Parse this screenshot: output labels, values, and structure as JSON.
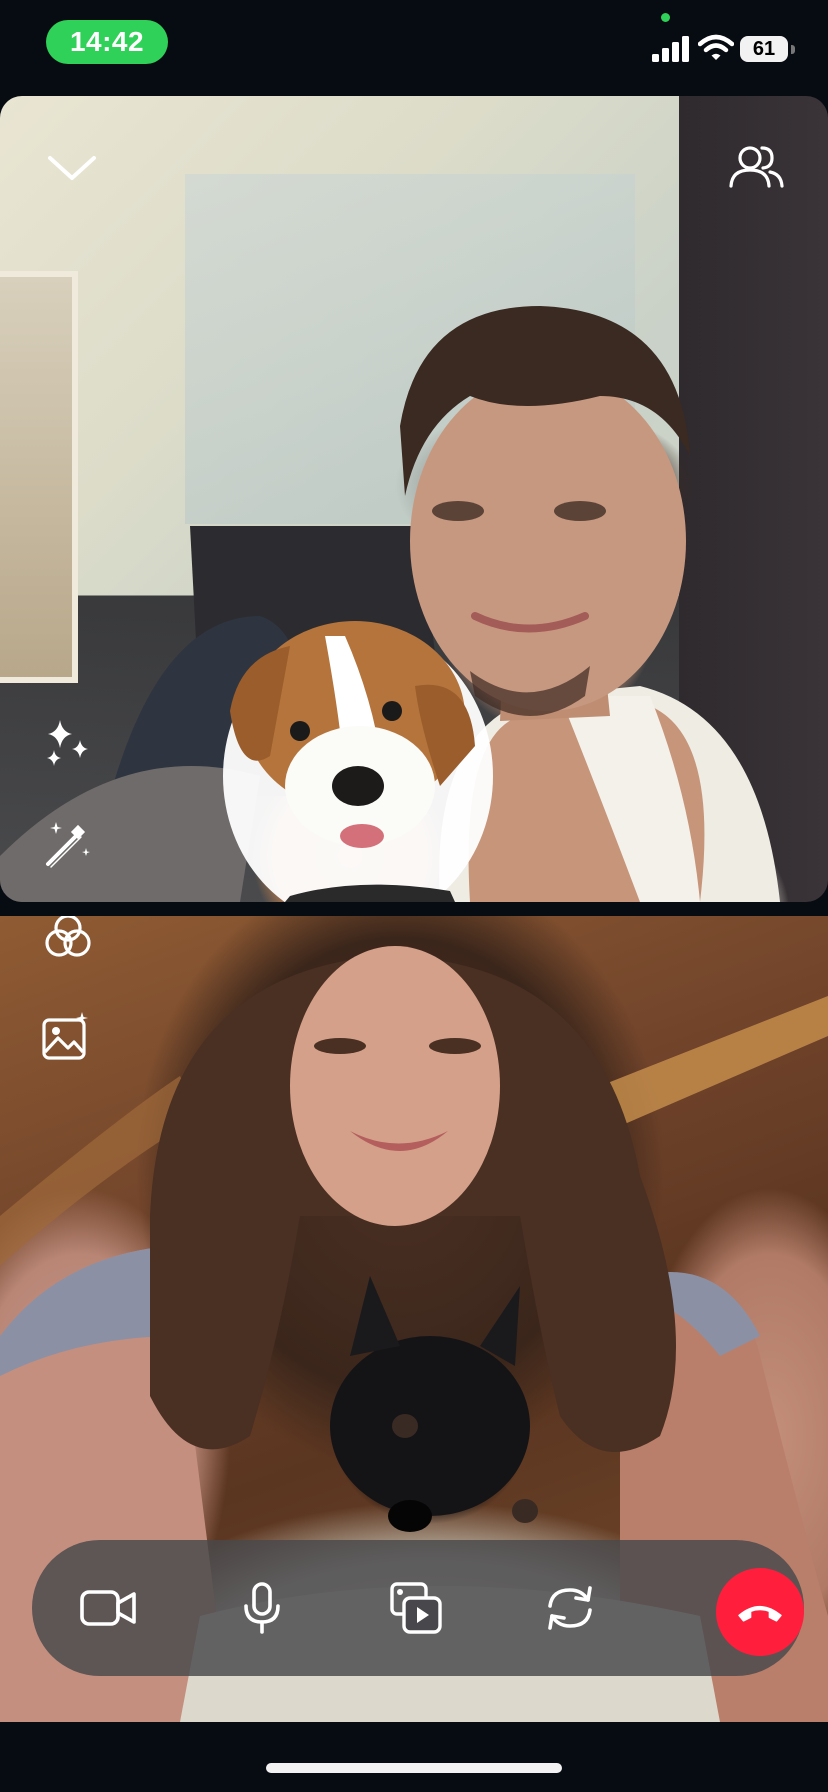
{
  "status_bar": {
    "time": "14:42",
    "battery": "61",
    "icons": [
      "signal-icon",
      "wifi-icon",
      "battery-icon"
    ],
    "time_pill_color": "#30d158"
  },
  "call": {
    "top_controls": [
      "chevron-down-icon",
      "participants-icon"
    ],
    "side_tools": [
      "sparkles-icon",
      "magic-wand-icon",
      "filters-icon",
      "background-image-icon"
    ],
    "controls": [
      "video-camera-icon",
      "microphone-icon",
      "share-screen-icon",
      "flip-camera-icon",
      "end-call-icon"
    ],
    "end_call_color": "#ff1f3d"
  }
}
